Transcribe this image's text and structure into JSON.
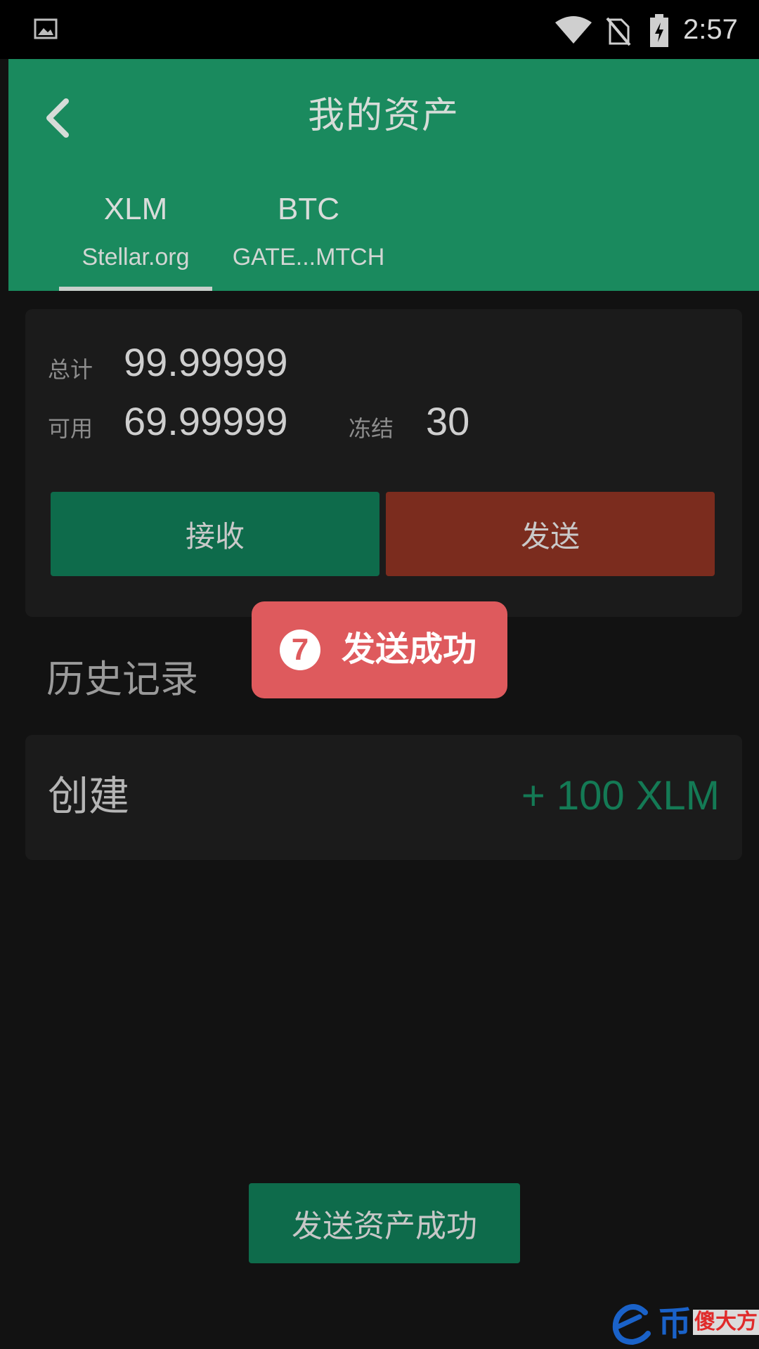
{
  "status_bar": {
    "time": "2:57",
    "icons": [
      "image-icon",
      "wifi-icon",
      "no-sim-icon",
      "battery-charging-icon"
    ]
  },
  "header": {
    "back_icon": "chevron-left-icon",
    "title": "我的资产",
    "tabs": [
      {
        "symbol": "XLM",
        "issuer": "Stellar.org",
        "selected": true
      },
      {
        "symbol": "BTC",
        "issuer": "GATE...MTCH",
        "selected": false
      }
    ]
  },
  "balance": {
    "total_label": "总计",
    "total_value": "99.99999",
    "available_label": "可用",
    "available_value": "69.99999",
    "frozen_label": "冻结",
    "frozen_value": "30",
    "receive_label": "接收",
    "send_label": "发送"
  },
  "history": {
    "title": "历史记录",
    "items": [
      {
        "type": "创建",
        "amount": "+ 100 XLM"
      }
    ]
  },
  "toast": {
    "badge": "7",
    "message": "发送成功"
  },
  "bottom_button": {
    "label": "发送资产成功"
  },
  "watermark": {
    "text": "币",
    "overlay": "傻大方"
  },
  "colors": {
    "header_green": "#1a8a5e",
    "button_green": "#0e6b4b",
    "button_red": "#7b2c1e",
    "toast_red": "#de5a5d",
    "amount_green": "#147a55",
    "background": "#121212"
  }
}
